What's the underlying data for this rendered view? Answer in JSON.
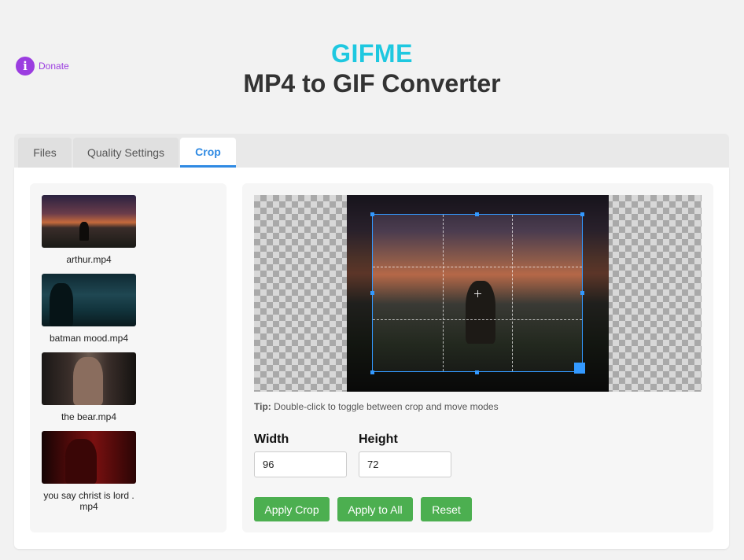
{
  "donate": {
    "label": "Donate",
    "icon": "info-icon",
    "color": "#9b3de0"
  },
  "header": {
    "brand": "GIFME",
    "brand_color": "#1ec8e0",
    "title": "MP4 to GIF Converter"
  },
  "tabs": [
    {
      "label": "Files",
      "active": false
    },
    {
      "label": "Quality Settings",
      "active": false
    },
    {
      "label": "Crop",
      "active": true
    }
  ],
  "files": [
    {
      "name": "arthur.mp4"
    },
    {
      "name": "batman mood.mp4"
    },
    {
      "name": "the bear.mp4"
    },
    {
      "name": "you say christ is lord .\nmp4"
    }
  ],
  "crop": {
    "tip_label": "Tip:",
    "tip_text": " Double-click to toggle between crop and move modes",
    "width_label": "Width",
    "width_value": "96",
    "height_label": "Height",
    "height_value": "72",
    "buttons": {
      "apply": "Apply Crop",
      "apply_all": "Apply to All",
      "reset": "Reset"
    }
  },
  "colors": {
    "accent": "#2f8ae3",
    "button": "#4caf50",
    "crop_handle": "#3399ff"
  }
}
